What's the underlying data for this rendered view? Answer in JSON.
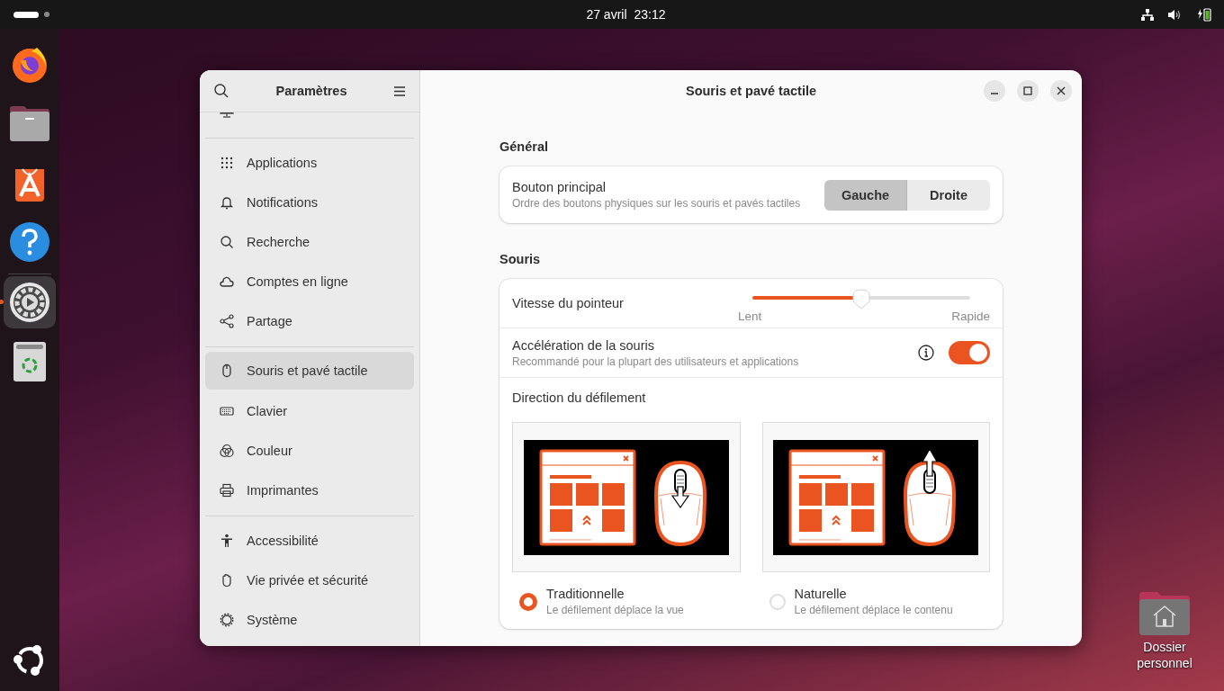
{
  "top_bar": {
    "date": "27 avril",
    "time": "23:12"
  },
  "dock": {
    "items": [
      {
        "active": false
      },
      {
        "active": false
      },
      {
        "active": false
      },
      {
        "active": false
      },
      {
        "active": true
      },
      {
        "active": false
      }
    ]
  },
  "window": {
    "title": "Souris et pavé tactile"
  },
  "sidebar": {
    "title": "Paramètres",
    "groups": [
      [
        {
          "label": "Applications",
          "selected": false
        },
        {
          "label": "Notifications",
          "selected": false
        },
        {
          "label": "Recherche",
          "selected": false
        },
        {
          "label": "Comptes en ligne",
          "selected": false
        },
        {
          "label": "Partage",
          "selected": false
        }
      ],
      [
        {
          "label": "Souris et pavé tactile",
          "selected": true
        },
        {
          "label": "Clavier",
          "selected": false
        },
        {
          "label": "Couleur",
          "selected": false
        },
        {
          "label": "Imprimantes",
          "selected": false
        }
      ],
      [
        {
          "label": "Accessibilité",
          "selected": false
        },
        {
          "label": "Vie privée et sécurité",
          "selected": false
        },
        {
          "label": "Système",
          "selected": false
        }
      ]
    ]
  },
  "general": {
    "heading": "Général",
    "primary_button": {
      "title": "Bouton principal",
      "subtitle": "Ordre des boutons physiques sur les souris et pavés tactiles",
      "options": [
        {
          "label": "Gauche",
          "selected": true
        },
        {
          "label": "Droite",
          "selected": false
        }
      ]
    }
  },
  "mouse": {
    "heading": "Souris",
    "pointer_speed": {
      "title": "Vitesse du pointeur",
      "level": 0.5,
      "min_label": "Lent",
      "max_label": "Rapide"
    },
    "acceleration": {
      "title": "Accélération de la souris",
      "subtitle": "Recommandé pour la plupart des utilisateurs et applications",
      "on": true
    },
    "scroll_direction": {
      "title": "Direction du défilement",
      "options": [
        {
          "label": "Traditionnelle",
          "description": "Le défilement déplace la vue",
          "selected": true
        },
        {
          "label": "Naturelle",
          "description": "Le défilement déplace le contenu",
          "selected": false
        }
      ]
    }
  },
  "desktop": {
    "home_folder": "Dossier personnel"
  }
}
